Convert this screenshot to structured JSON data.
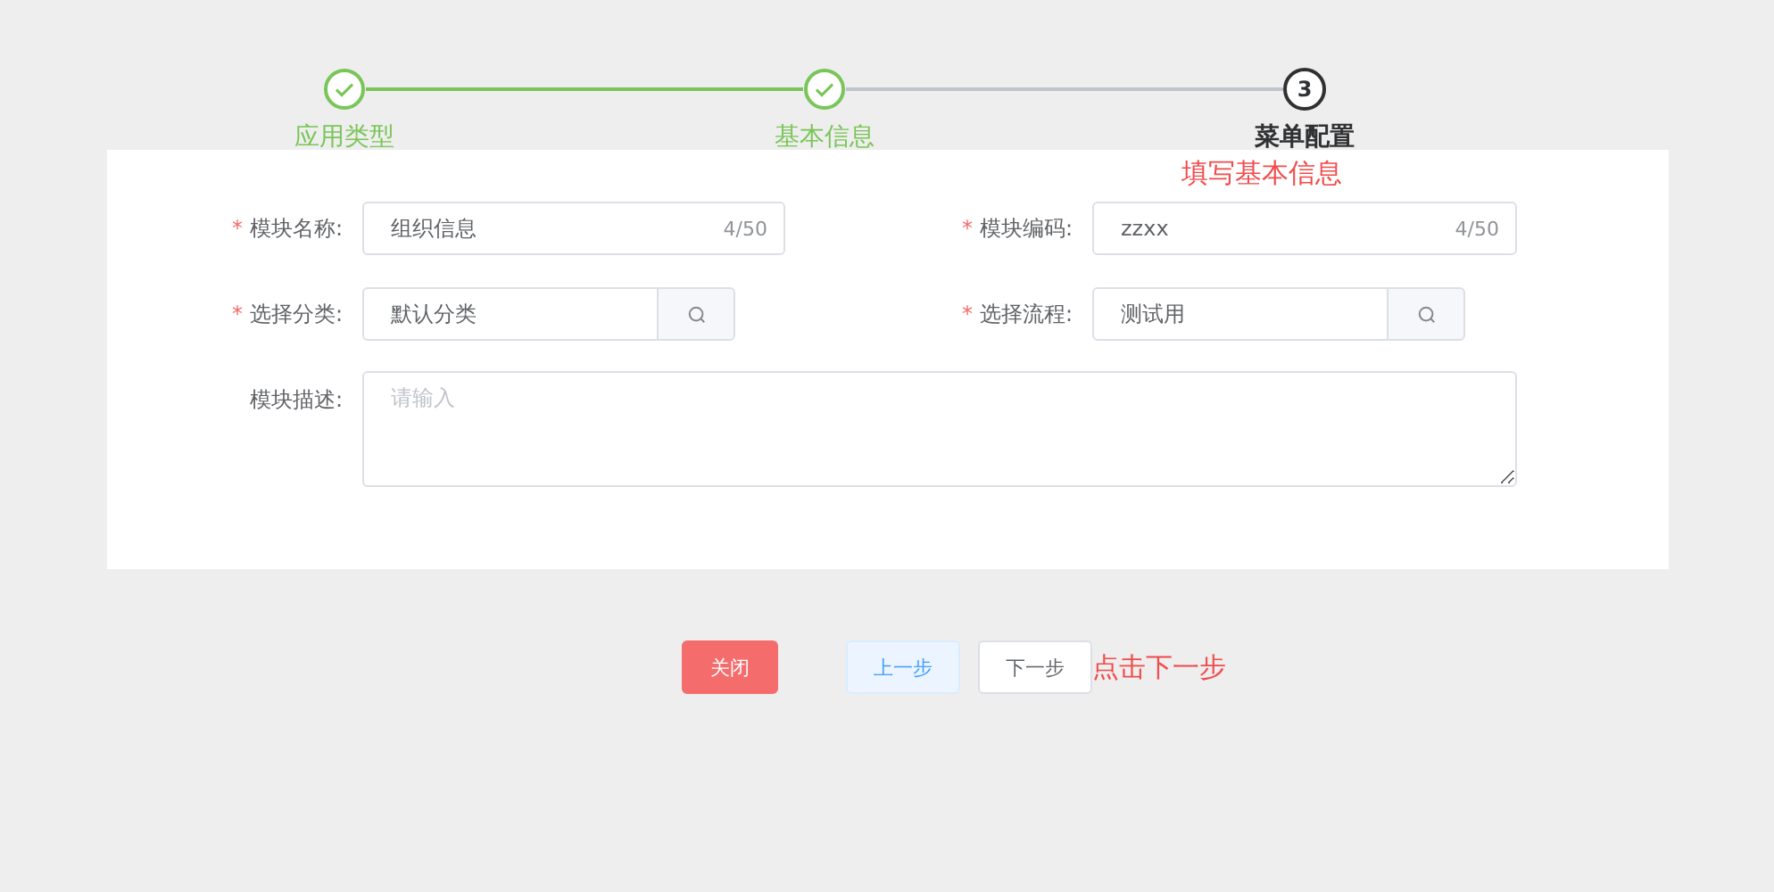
{
  "steps": [
    {
      "label": "应用类型",
      "done": true
    },
    {
      "label": "基本信息",
      "done": true
    },
    {
      "number": "3",
      "label": "菜单配置",
      "done": false
    }
  ],
  "form": {
    "annotation": "填写基本信息",
    "fields": [
      {
        "kind": "count",
        "label": "模块名称:",
        "required_mark": "*",
        "value": "组织信息",
        "count": "4/50"
      },
      {
        "kind": "count",
        "label": "模块编码:",
        "required_mark": "*",
        "value": "zzxx",
        "count": "4/50"
      },
      {
        "kind": "search",
        "label": "选择分类:",
        "required_mark": "*",
        "value": "默认分类"
      },
      {
        "kind": "search",
        "label": "选择流程:",
        "required_mark": "*",
        "value": "测试用"
      },
      {
        "kind": "textarea",
        "label": "模块描述:",
        "placeholder": "请输入"
      }
    ]
  },
  "buttons": [
    {
      "label": "关闭",
      "kind": "danger"
    },
    {
      "label": "上一步",
      "kind": "plain"
    },
    {
      "label": "下一步",
      "kind": "default"
    }
  ],
  "footer_annotation": "点击下一步"
}
